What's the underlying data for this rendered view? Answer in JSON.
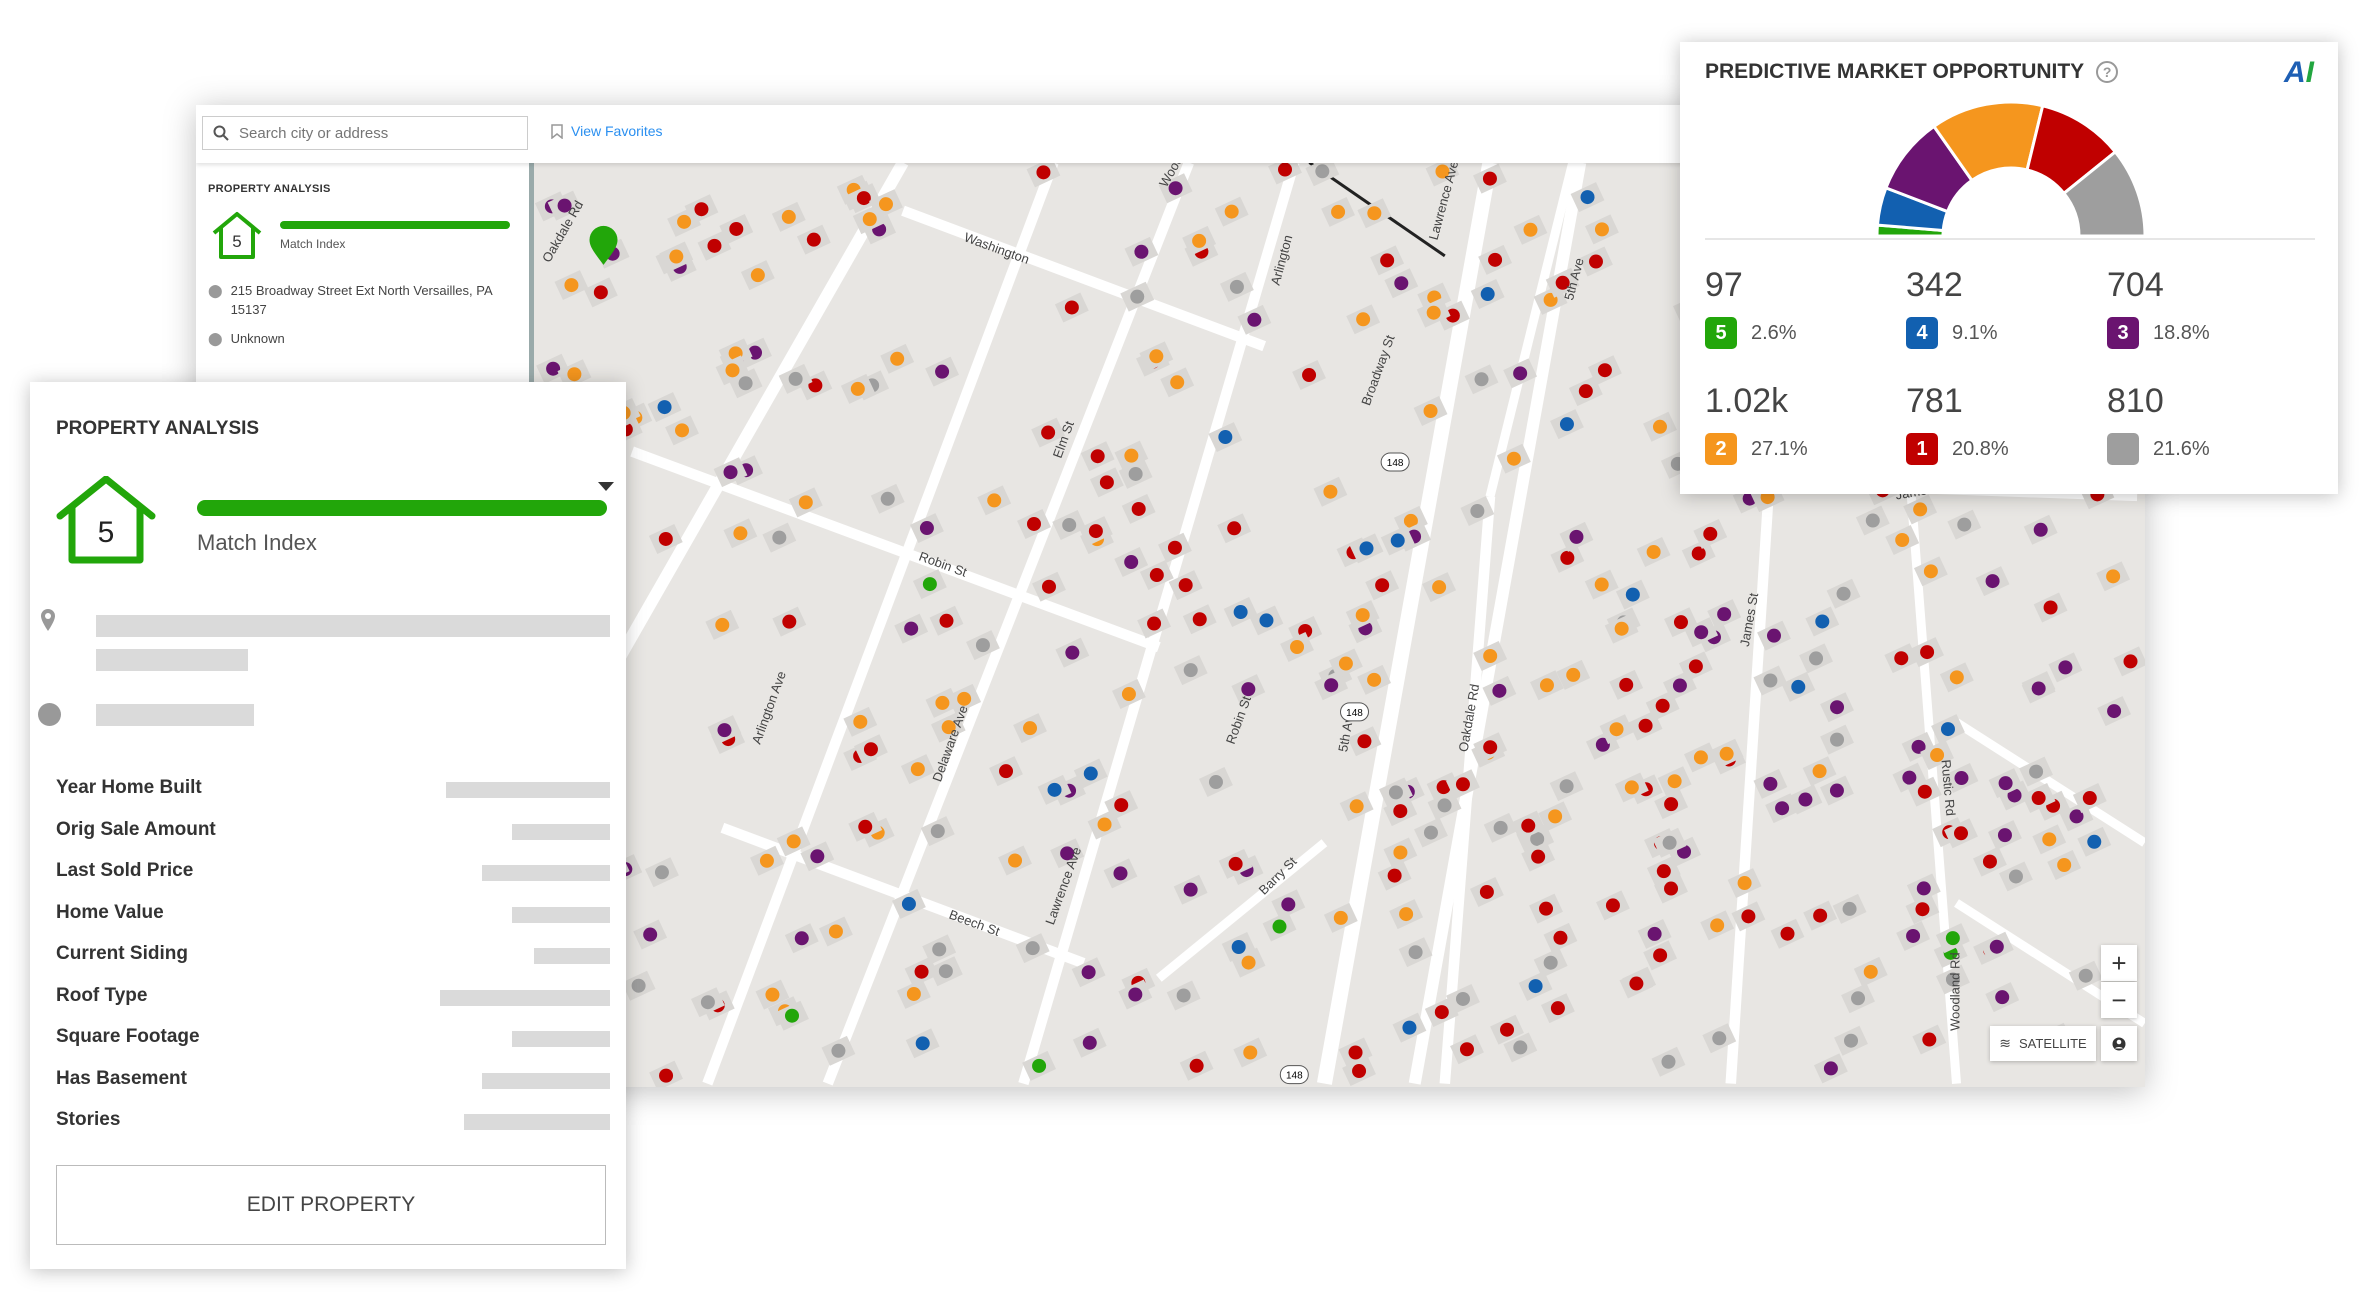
{
  "topbar": {
    "search_placeholder": "Search city or address",
    "view_favorites": "View Favorites"
  },
  "sidebar": {
    "title": "PROPERTY ANALYSIS",
    "match_score": "5",
    "match_label": "Match Index",
    "address": "215 Broadway Street Ext North Versailles, PA 15137",
    "status": "Unknown"
  },
  "card": {
    "title": "PROPERTY ANALYSIS",
    "match_score": "5",
    "match_label": "Match Index",
    "match_index_level": 1.0,
    "attributes": [
      "Year Home Built",
      "Orig Sale Amount",
      "Last Sold Price",
      "Home Value",
      "Current Siding",
      "Roof Type",
      "Square Footage",
      "Has Basement",
      "Stories"
    ],
    "edit_button": "EDIT PROPERTY"
  },
  "pmo": {
    "title": "PREDICTIVE MARKET OPPORTUNITY",
    "logo": "AI",
    "segments": [
      {
        "score": "5",
        "count": "97",
        "pct": "2.6%",
        "value": 2.6,
        "color": "#22a60a"
      },
      {
        "score": "4",
        "count": "342",
        "pct": "9.1%",
        "value": 9.1,
        "color": "#1260b0"
      },
      {
        "score": "3",
        "count": "704",
        "pct": "18.8%",
        "value": 18.8,
        "color": "#6a1470"
      },
      {
        "score": "2",
        "count": "1.02k",
        "pct": "27.1%",
        "value": 27.1,
        "color": "#f5961e"
      },
      {
        "score": "1",
        "count": "781",
        "pct": "20.8%",
        "value": 20.8,
        "color": "#c00000"
      },
      {
        "score": "",
        "count": "810",
        "pct": "21.6%",
        "value": 21.6,
        "color": "#9e9e9e"
      }
    ]
  },
  "map": {
    "streets": [
      "Washington",
      "Wood St",
      "Arlington",
      "Lawrence Ave",
      "5th Ave",
      "Oakdale Rd",
      "Broadway St",
      "Robin St",
      "Elm St",
      "Arlington Ave",
      "Delaware Ave",
      "Beech St",
      "Lawrence Ave",
      "Robin St",
      "5th Ave",
      "Oakdale Rd",
      "Barry St",
      "James St",
      "James Ave",
      "Rustic Rd",
      "Woodland Rd"
    ],
    "route_shield": "148",
    "satellite": "SATELLITE",
    "zoom_in": "+",
    "zoom_out": "−",
    "marker_colors": [
      "#c00000",
      "#f5961e",
      "#6a1470",
      "#9e9e9e",
      "#1260b0",
      "#22a60a"
    ]
  }
}
